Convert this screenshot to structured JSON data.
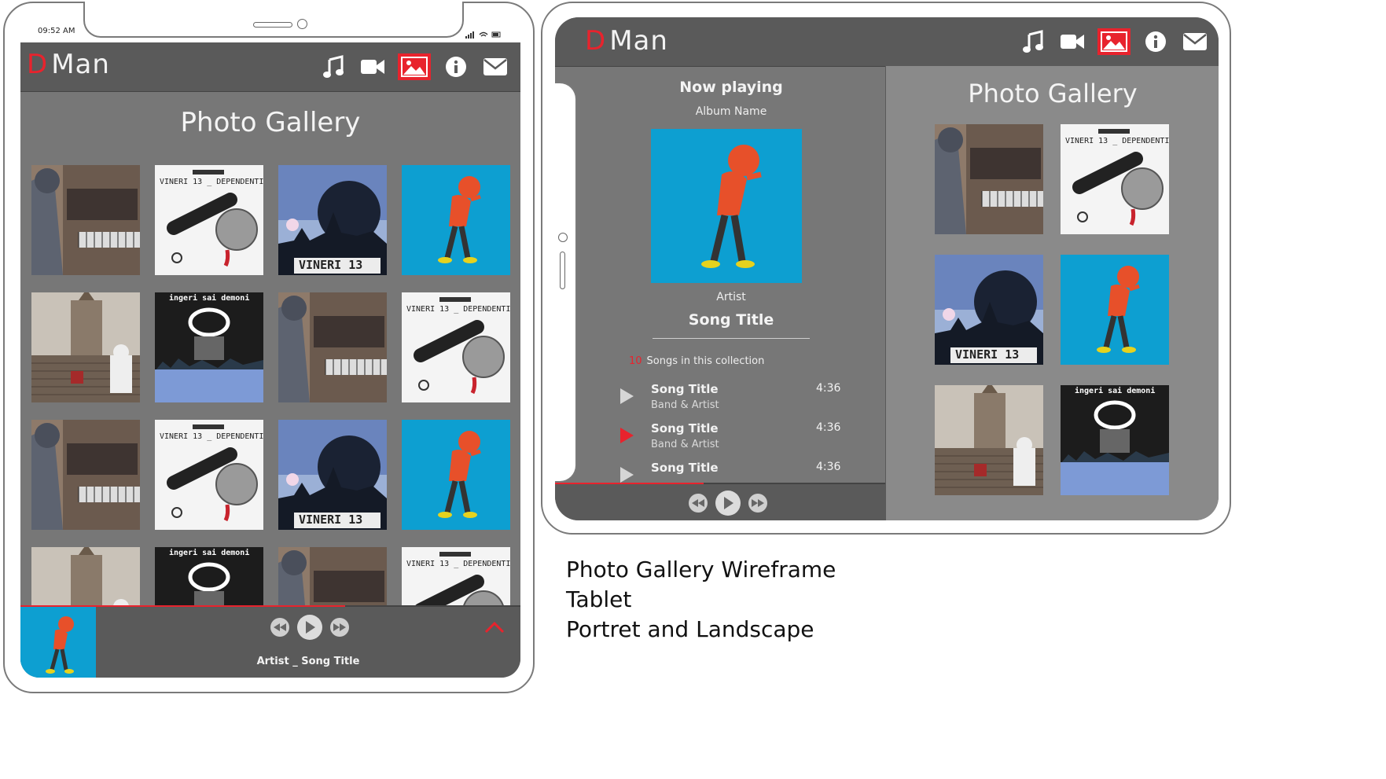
{
  "portrait": {
    "status_time": "09:52 AM",
    "logo_d": "D",
    "logo_text": "Man",
    "gallery_title": "Photo Gallery",
    "thumbs": [
      {
        "kind": "piano",
        "caption": ""
      },
      {
        "kind": "mic",
        "caption": "VINERI 13 _ DEPENDENTI"
      },
      {
        "kind": "city",
        "caption": "VINERI 13"
      },
      {
        "kind": "walker",
        "caption": ""
      },
      {
        "kind": "stairs",
        "caption": ""
      },
      {
        "kind": "dark",
        "caption": "ingeri sai demoni"
      },
      {
        "kind": "piano",
        "caption": ""
      },
      {
        "kind": "mic",
        "caption": "VINERI 13 _ DEPENDENTI"
      },
      {
        "kind": "piano",
        "caption": ""
      },
      {
        "kind": "mic",
        "caption": "VINERI 13 _ DEPENDENTI"
      },
      {
        "kind": "city",
        "caption": "VINERI 13"
      },
      {
        "kind": "walker",
        "caption": ""
      },
      {
        "kind": "stairs",
        "caption": ""
      },
      {
        "kind": "dark",
        "caption": "ingeri sai demoni"
      },
      {
        "kind": "piano",
        "caption": ""
      },
      {
        "kind": "mic",
        "caption": "VINERI 13 _ DEPENDENTI"
      }
    ],
    "player": {
      "now_playing_label": "Artist _ Song Title",
      "progress": 0.65
    }
  },
  "landscape": {
    "logo_d": "D",
    "logo_text": "Man",
    "now_playing": "Now playing",
    "album_name": "Album Name",
    "artist": "Artist",
    "song_title": "Song Title",
    "song_count": "10",
    "songs_label": "Songs in this collection",
    "songs": [
      {
        "title": "Song Title",
        "band": "Band & Artist",
        "time": "4:36",
        "active": false
      },
      {
        "title": "Song Title",
        "band": "Band & Artist",
        "time": "4:36",
        "active": true
      },
      {
        "title": "Song Title",
        "band": "",
        "time": "4:36",
        "active": false
      }
    ],
    "gallery_title": "Photo Gallery",
    "thumbs": [
      {
        "kind": "piano",
        "caption": ""
      },
      {
        "kind": "mic",
        "caption": "VINERI 13 _ DEPENDENTI"
      },
      {
        "kind": "city",
        "caption": "VINERI 13"
      },
      {
        "kind": "walker",
        "caption": ""
      },
      {
        "kind": "stairs",
        "caption": ""
      },
      {
        "kind": "dark",
        "caption": "ingeri sai demoni"
      }
    ],
    "progress": 0.45
  },
  "caption": {
    "line1": "Photo Gallery Wireframe",
    "line2": "Tablet",
    "line3": "Portret and Landscape"
  },
  "colors": {
    "accent": "#e8232d",
    "appbar": "#5a5a5a",
    "screen": "#777777",
    "panel_right": "#8a8a8a",
    "walker_bg": "#0d9fd1"
  },
  "icons": [
    "music-icon",
    "video-icon",
    "photo-icon",
    "info-icon",
    "mail-icon"
  ]
}
